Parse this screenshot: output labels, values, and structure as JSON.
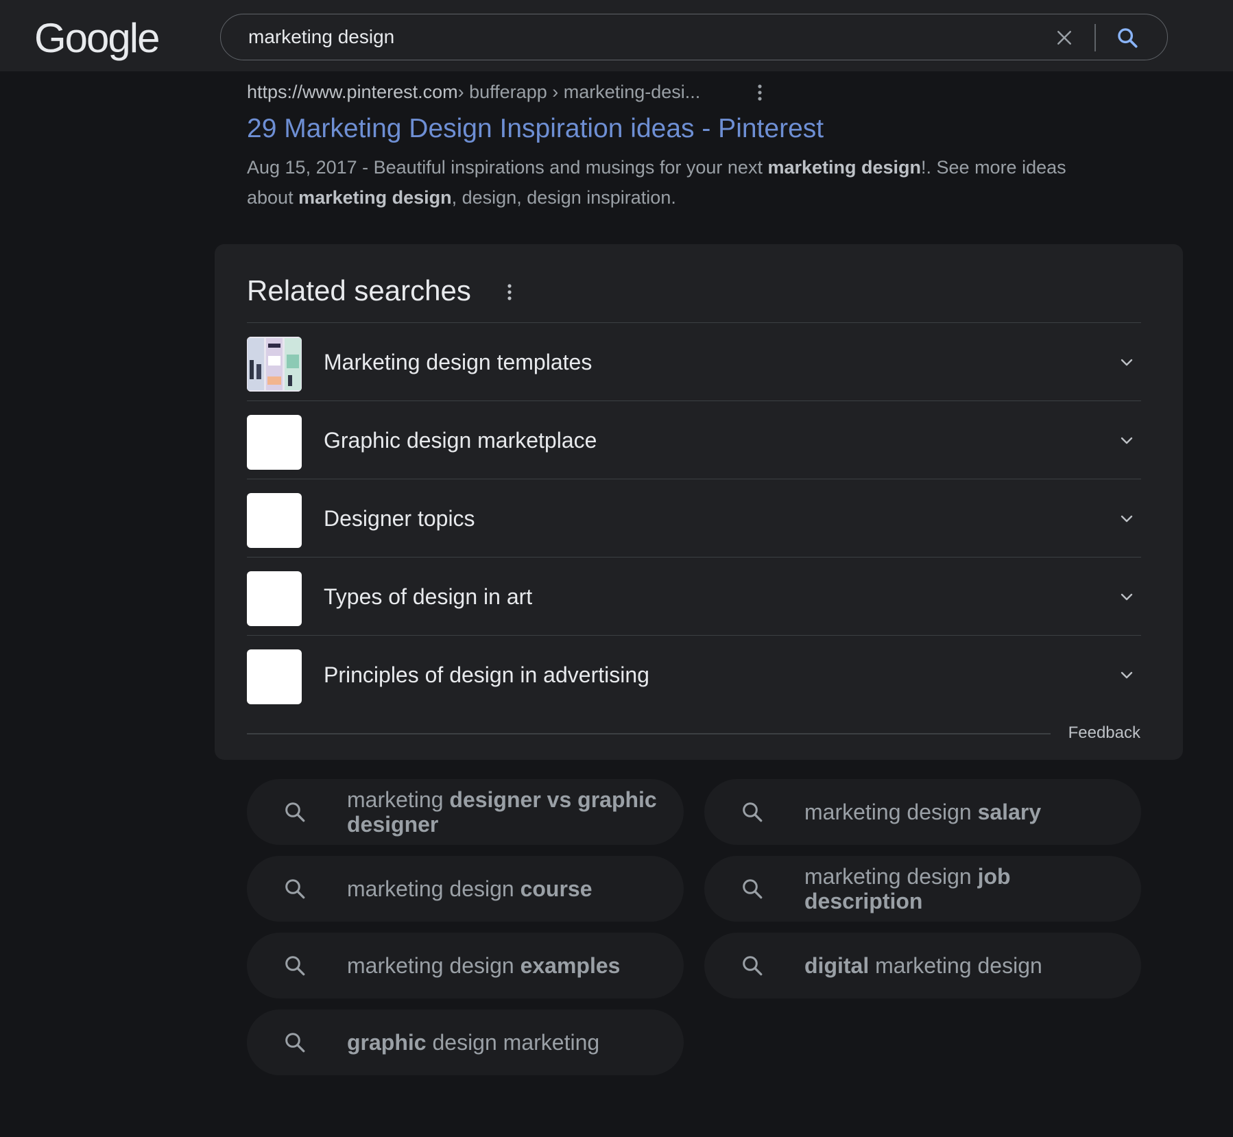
{
  "header": {
    "logo_text": "Google",
    "search_value": "marketing design",
    "search_placeholder": ""
  },
  "result": {
    "url_host": "https://www.pinterest.com",
    "url_path": " › bufferapp › marketing-desi...",
    "title": "29 Marketing Design Inspiration ideas - Pinterest",
    "snippet_parts": [
      {
        "text": "Aug 15, 2017 - Beautiful inspirations and musings for your next ",
        "bold": false
      },
      {
        "text": "marketing design",
        "bold": true
      },
      {
        "text": "!. See more ideas about ",
        "bold": false
      },
      {
        "text": "marketing design",
        "bold": true
      },
      {
        "text": ", design, design inspiration.",
        "bold": false
      }
    ]
  },
  "related": {
    "title": "Related searches",
    "items": [
      {
        "label": "Marketing design templates",
        "thumb": "template-collage"
      },
      {
        "label": "Graphic design marketplace",
        "thumb": "blank"
      },
      {
        "label": "Designer topics",
        "thumb": "blank"
      },
      {
        "label": "Types of design in art",
        "thumb": "blank"
      },
      {
        "label": "Principles of design in advertising",
        "thumb": "blank"
      }
    ],
    "feedback_label": "Feedback"
  },
  "chips": [
    {
      "parts": [
        {
          "text": "marketing ",
          "bold": false
        },
        {
          "text": "designer vs graphic designer",
          "bold": true
        }
      ]
    },
    {
      "parts": [
        {
          "text": "marketing design ",
          "bold": false
        },
        {
          "text": "salary",
          "bold": true
        }
      ]
    },
    {
      "parts": [
        {
          "text": "marketing design ",
          "bold": false
        },
        {
          "text": "course",
          "bold": true
        }
      ]
    },
    {
      "parts": [
        {
          "text": "marketing design ",
          "bold": false
        },
        {
          "text": "job description",
          "bold": true
        }
      ]
    },
    {
      "parts": [
        {
          "text": "marketing design ",
          "bold": false
        },
        {
          "text": "examples",
          "bold": true
        }
      ]
    },
    {
      "parts": [
        {
          "text": "digital",
          "bold": true
        },
        {
          "text": " marketing design",
          "bold": false
        }
      ]
    },
    {
      "parts": [
        {
          "text": "graphic",
          "bold": true
        },
        {
          "text": " design marketing",
          "bold": false
        }
      ]
    }
  ],
  "colors": {
    "background": "#141518",
    "header_bg": "#202124",
    "link_blue": "#6e8fd4",
    "search_icon_blue": "#8ab4f8",
    "card_bg": "#202124",
    "chip_bg": "#1c1d20"
  },
  "icons": {
    "clear": "close-icon",
    "search": "search-icon",
    "menu": "more-vert-icon",
    "chevron": "chevron-down-icon"
  }
}
